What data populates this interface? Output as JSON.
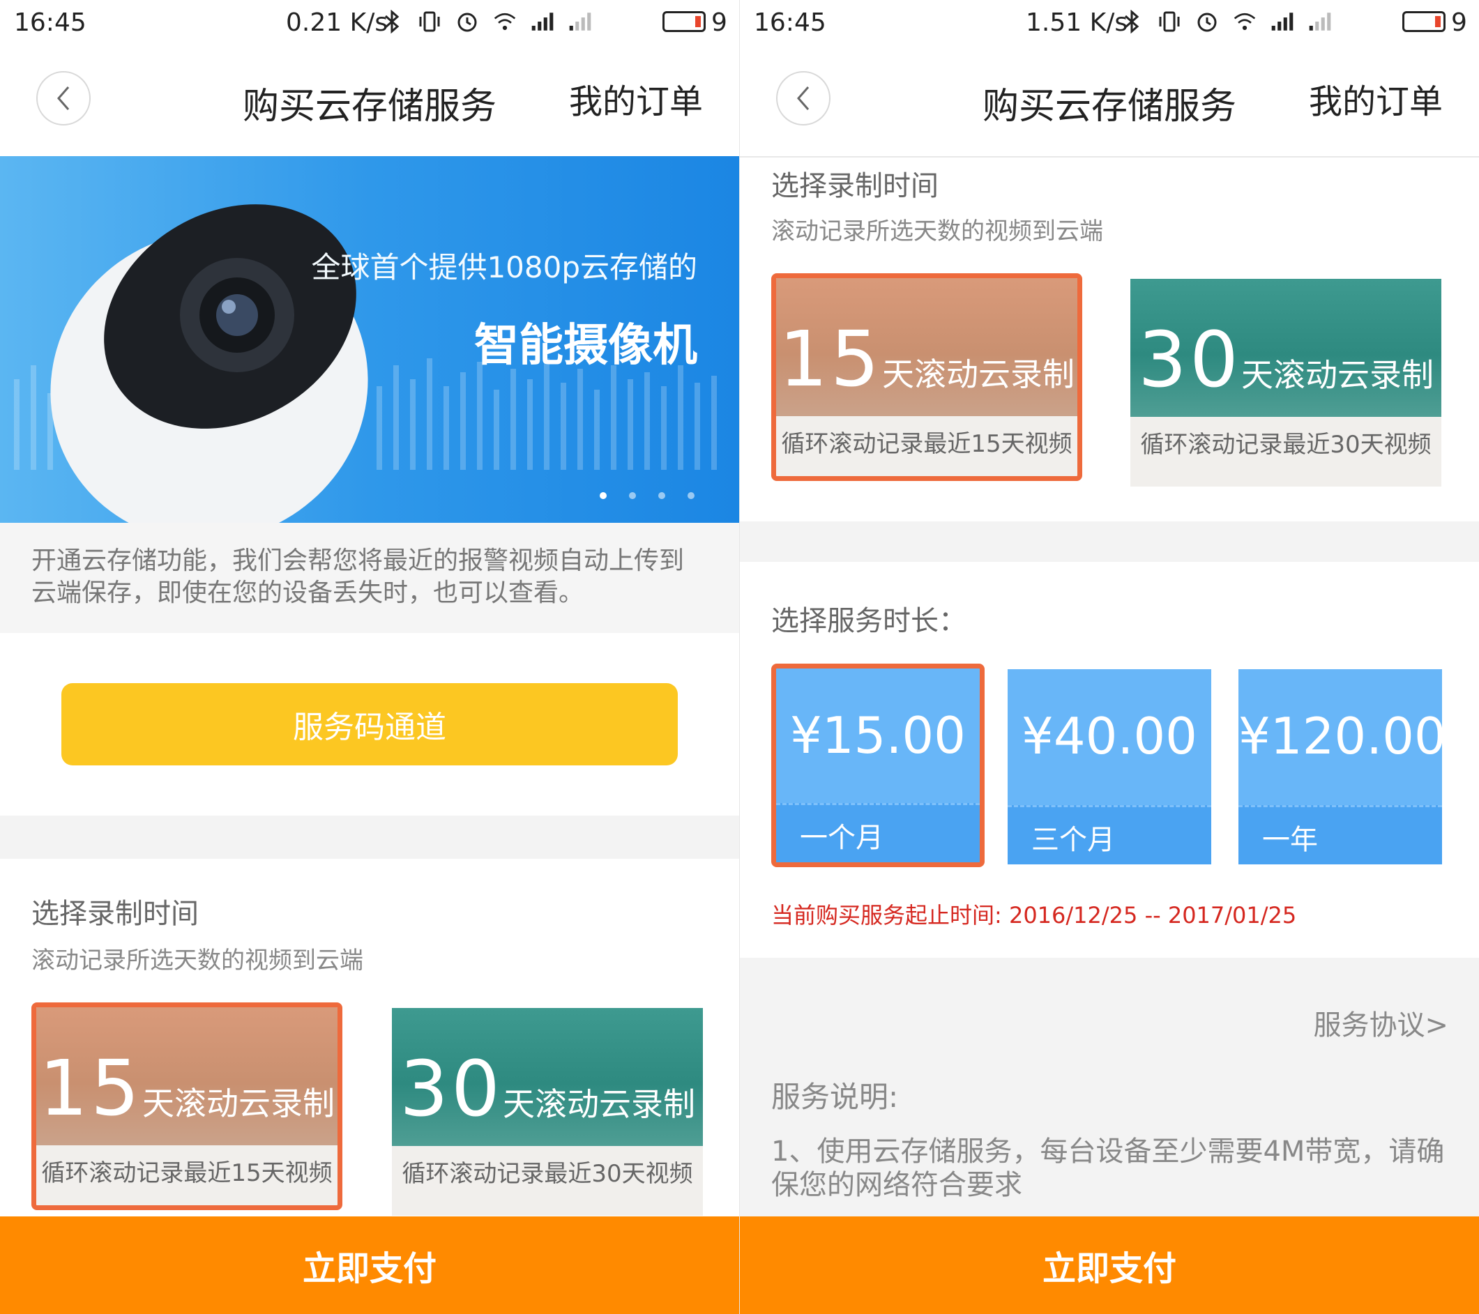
{
  "status_left": {
    "time": "16:45",
    "speed": "0.21 K/s",
    "battery": "9"
  },
  "status_right": {
    "time": "16:45",
    "speed": "1.51 K/s",
    "battery": "9"
  },
  "header": {
    "title": "购买云存储服务",
    "orders_link": "我的订单"
  },
  "banner": {
    "line1": "全球首个提供1080p云存储的",
    "line2": "智能摄像机",
    "active_slide": 1,
    "slide_count": 4
  },
  "intro_text": "开通云存储功能，我们会帮您将最近的报警视频自动上传到云端保存，即使在您的设备丢失时，也可以查看。",
  "service_code_button": "服务码通道",
  "record_section": {
    "title": "选择录制时间",
    "subtitle": "滚动记录所选天数的视频到云端",
    "plans": [
      {
        "days": "15",
        "unit": "天滚动云录制",
        "desc": "循环滚动记录最近15天视频",
        "selected": true
      },
      {
        "days": "30",
        "unit": "天滚动云录制",
        "desc": "循环滚动记录最近30天视频",
        "selected": false
      }
    ]
  },
  "duration_section": {
    "title": "选择服务时长：",
    "options": [
      {
        "price": "¥15.00",
        "label": "一个月",
        "selected": true
      },
      {
        "price": "¥40.00",
        "label": "三个月",
        "selected": false
      },
      {
        "price": "¥120.00",
        "label": "一年",
        "selected": false
      }
    ]
  },
  "service_period": "当前购买服务起止时间: 2016/12/25 -- 2017/01/25",
  "agreement_link": "服务协议>",
  "service_notes": {
    "title": "服务说明:",
    "items": [
      "1、使用云存储服务，每台设备至少需要4M带宽，请确保您的网络符合要求"
    ]
  },
  "pay_button": "立即支付",
  "colors": {
    "accent_orange": "#ff8a00",
    "selected_border": "#ee6a3c",
    "code_button": "#fcc722",
    "price_card": "#68b6f8",
    "period_text": "#d5271f"
  }
}
